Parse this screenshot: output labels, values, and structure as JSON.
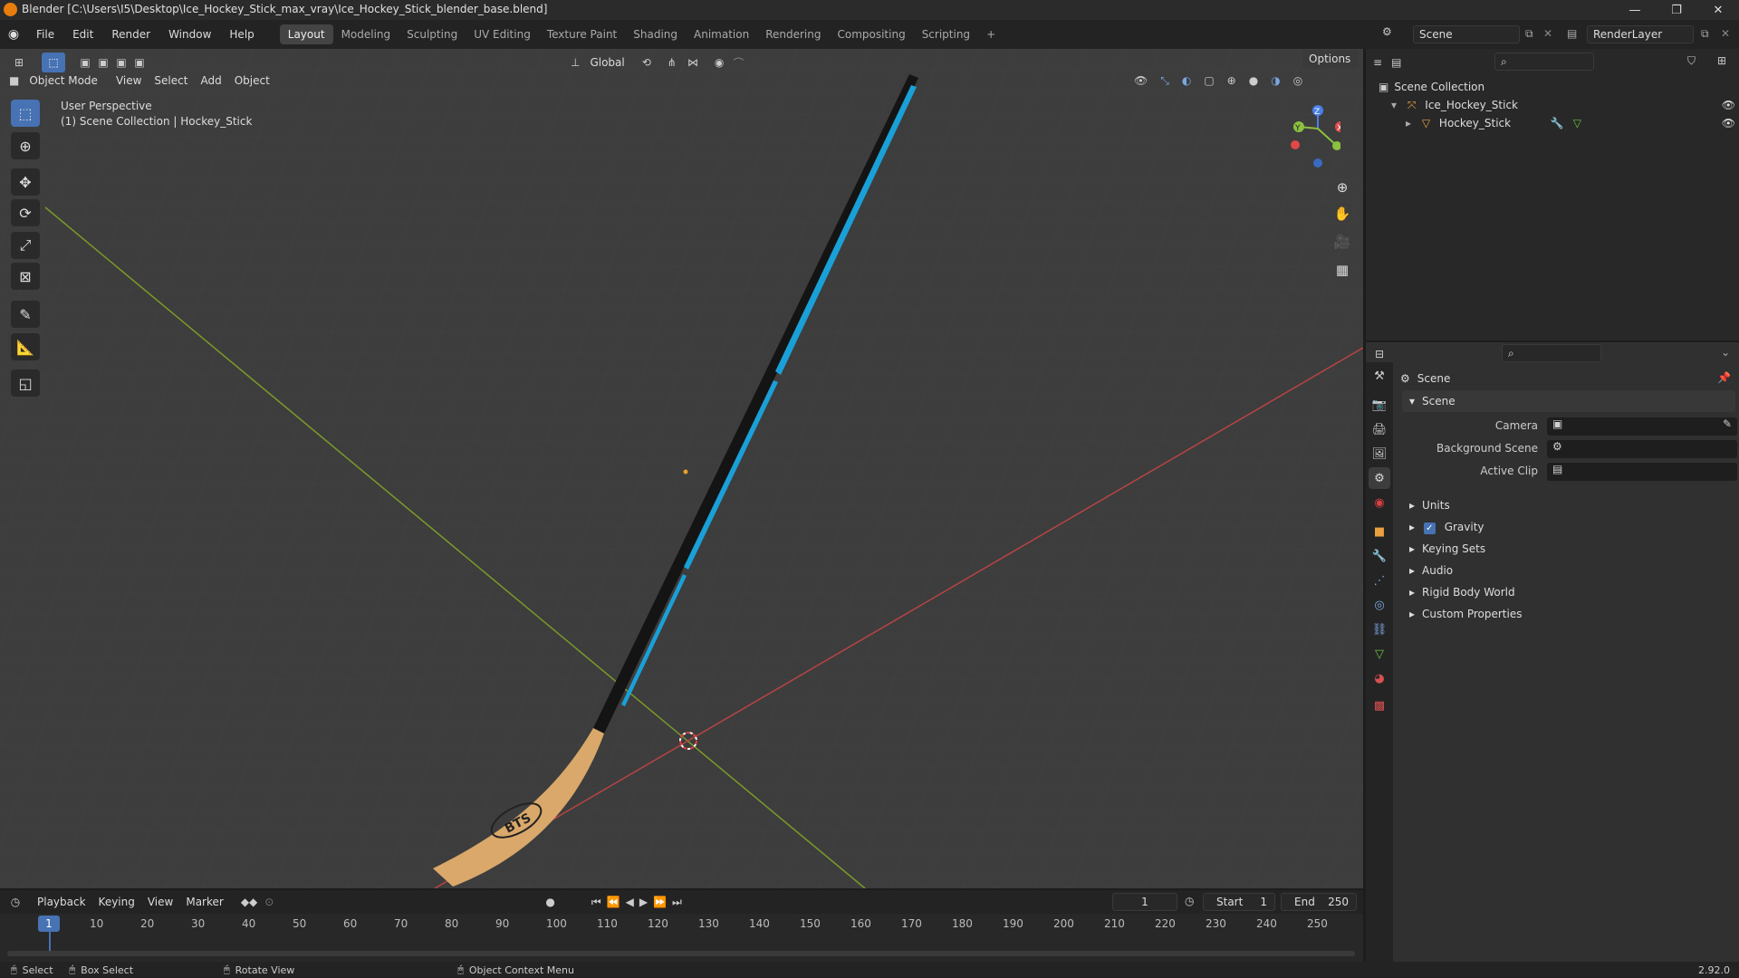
{
  "window": {
    "title": "Blender [C:\\Users\\I5\\Desktop\\Ice_Hockey_Stick_max_vray\\Ice_Hockey_Stick_blender_base.blend]",
    "min": "—",
    "max": "❐",
    "close": "✕"
  },
  "menu": [
    "File",
    "Edit",
    "Render",
    "Window",
    "Help"
  ],
  "workspaces": [
    "Layout",
    "Modeling",
    "Sculpting",
    "UV Editing",
    "Texture Paint",
    "Shading",
    "Animation",
    "Rendering",
    "Compositing",
    "Scripting"
  ],
  "workspace_add": "+",
  "scene_selector": {
    "scene": "Scene",
    "render_layer": "RenderLayer"
  },
  "viewport": {
    "mode": "Object Mode",
    "menus": [
      "View",
      "Select",
      "Add",
      "Object"
    ],
    "transform": "Global",
    "options": "Options",
    "info_line1": "User Perspective",
    "info_line2": "(1) Scene Collection | Hockey_Stick",
    "stick_logo": "BTS",
    "gizmo": {
      "z": "Z",
      "y": "Y",
      "x": "X"
    }
  },
  "outliner": {
    "root": "Scene Collection",
    "items": [
      {
        "label": "Ice_Hockey_Stick"
      },
      {
        "label": "Hockey_Stick"
      }
    ]
  },
  "properties": {
    "context": "Scene",
    "panel_title": "Scene",
    "fields": [
      {
        "label": "Camera"
      },
      {
        "label": "Background Scene"
      },
      {
        "label": "Active Clip"
      }
    ],
    "sections": [
      "Units",
      "Gravity",
      "Keying Sets",
      "Audio",
      "Rigid Body World",
      "Custom Properties"
    ],
    "gravity_checked": true
  },
  "timeline": {
    "menus": [
      "Playback",
      "Keying",
      "View",
      "Marker"
    ],
    "current_frame": "1",
    "start_label": "Start",
    "start": "1",
    "end_label": "End",
    "end": "250",
    "ticks": [
      "1",
      "10",
      "20",
      "30",
      "40",
      "50",
      "60",
      "70",
      "80",
      "90",
      "100",
      "110",
      "120",
      "130",
      "140",
      "150",
      "160",
      "170",
      "180",
      "190",
      "200",
      "210",
      "220",
      "230",
      "240",
      "250"
    ]
  },
  "statusbar": {
    "select": "Select",
    "box_select": "Box Select",
    "rotate": "Rotate View",
    "context_menu": "Object Context Menu",
    "version": "2.92.0"
  },
  "colors": {
    "accent": "#4772b3",
    "stick_blue": "#1aa0d8",
    "blade_wood": "#d9a86a",
    "axis_x": "#b84444",
    "axis_y": "#7a9a2a"
  }
}
